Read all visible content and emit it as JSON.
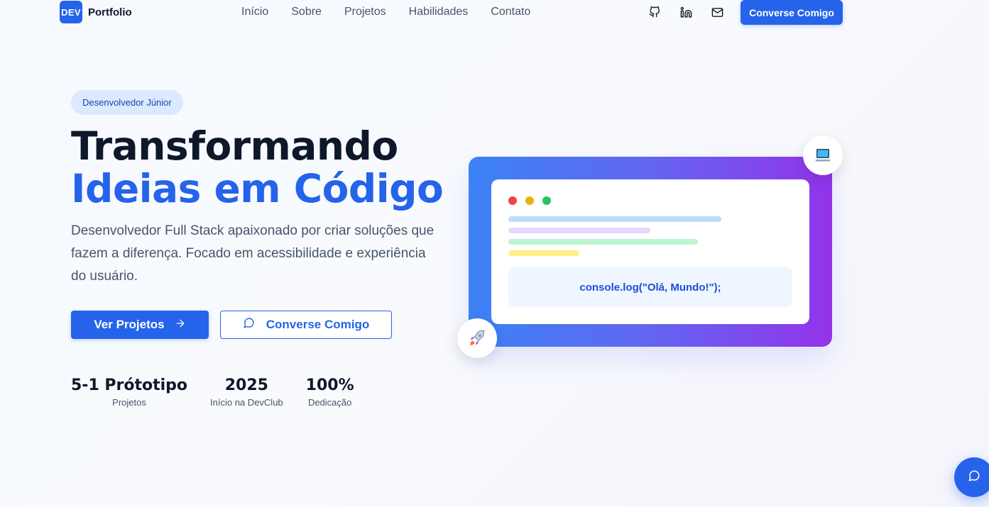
{
  "nav": {
    "logo_badge": "DEV",
    "logo_text": "Portfolio",
    "links": [
      "Início",
      "Sobre",
      "Projetos",
      "Habilidades",
      "Contato"
    ],
    "icons": [
      "github-icon",
      "linkedin-icon",
      "mail-icon"
    ],
    "cta_label": "Converse Comigo"
  },
  "hero": {
    "badge": "Desenvolvedor Júnior",
    "title_line1": "Transformando",
    "title_line2": "Ideias em Código",
    "subtitle": "Desenvolvedor Full Stack apaixonado por criar soluções que fazem a diferença. Focado em acessibilidade e experiência do usuário.",
    "primary_button": "Ver Projetos",
    "secondary_button": "Converse Comigo",
    "stats": [
      {
        "value": "5-1 Prótotipo",
        "label": "Projetos"
      },
      {
        "value": "2025",
        "label": "Início na DevClub"
      },
      {
        "value": "100%",
        "label": "Dedicação"
      }
    ]
  },
  "mockup": {
    "code_text": "console.log(\"Olá, Mundo!\");",
    "icons": [
      "laptop-icon",
      "rocket-icon"
    ]
  },
  "colors": {
    "accent": "#2563eb",
    "heading": "#0f172a",
    "badge_bg": "#dbeafe",
    "gradient_start": "#3b82f6",
    "gradient_end": "#9333ea"
  },
  "chat": {
    "icon": "chat-bubble-icon"
  }
}
